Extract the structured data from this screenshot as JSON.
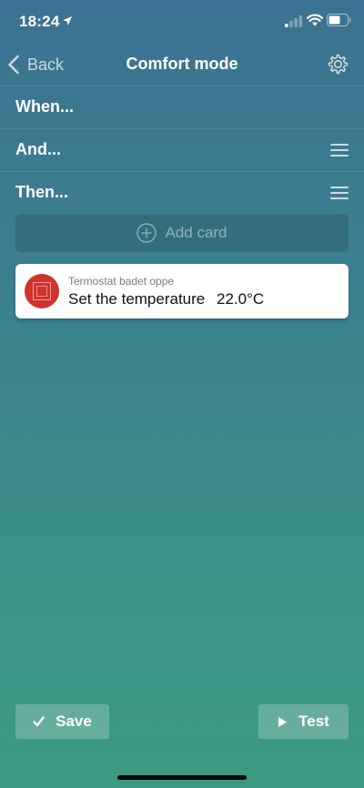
{
  "status_bar": {
    "time": "18:24"
  },
  "nav": {
    "back_label": "Back",
    "title": "Comfort mode"
  },
  "sections": {
    "when_label": "When...",
    "and_label": "And...",
    "then_label": "Then..."
  },
  "add_card": {
    "label": "Add card"
  },
  "action_card": {
    "device_name": "Termostat badet oppe",
    "action_text": "Set the temperature",
    "value": "22.0°C",
    "icon_color": "#d0332d"
  },
  "bottom_bar": {
    "save_label": "Save",
    "test_label": "Test"
  }
}
